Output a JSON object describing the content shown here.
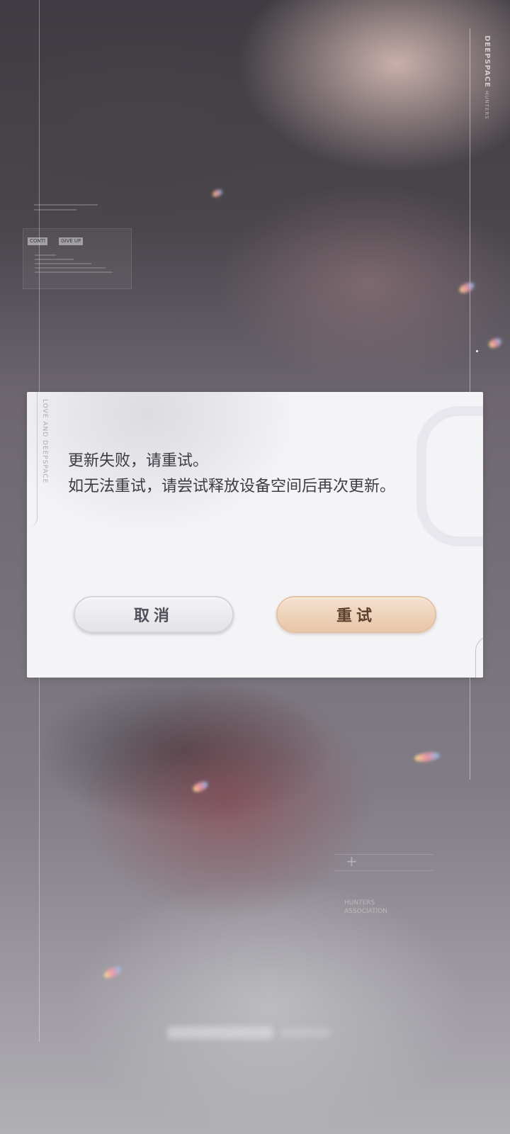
{
  "background": {
    "brand_vertical": "DEEPSPACE",
    "brand_sub": "HUNTERS",
    "hud_continue": "CONTI",
    "hud_giveup": "GIVE UP",
    "hunters_label": "HUNTERS\nASSOCIATION"
  },
  "dialog": {
    "vertical_text": "LOVE AND DEEPSPACE",
    "message_line1": "更新失败，请重试。",
    "message_line2": "如无法重试，请尝试释放设备空间后再次更新。",
    "cancel_label": "取消",
    "retry_label": "重试"
  },
  "colors": {
    "dialog_bg": "#f4f4f7",
    "cancel_button": "#e8e8ec",
    "retry_button": "#edd2b9",
    "message_text": "#3c3c44"
  }
}
